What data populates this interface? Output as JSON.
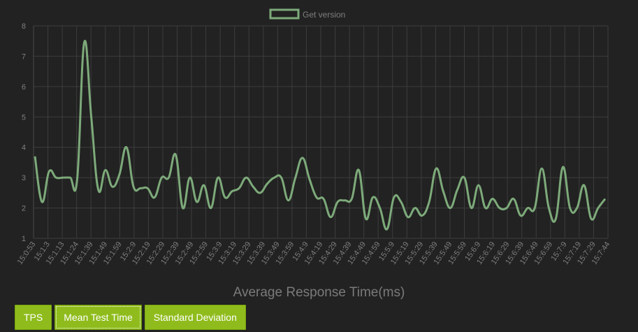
{
  "colors": {
    "background": "#222222",
    "grid": "#3d3d3d",
    "axis_text": "#7f7f7f",
    "series": "#7daa7a",
    "button": "#8fbc1c"
  },
  "buttons": [
    {
      "label": "TPS",
      "active": false
    },
    {
      "label": "Mean Test Time",
      "active": true
    },
    {
      "label": "Standard Deviation",
      "active": false
    }
  ],
  "chart_data": {
    "type": "line",
    "title": "Average Response Time(ms)",
    "legend_position": "top-center",
    "grid": true,
    "ylim": [
      1,
      8
    ],
    "yticks": [
      1,
      2,
      3,
      4,
      5,
      6,
      7,
      8
    ],
    "x": [
      "15:0:53",
      "15:1:3",
      "15:1:13",
      "15:1:24",
      "15:1:39",
      "15:1:49",
      "15:1:59",
      "15:2:9",
      "15:2:19",
      "15:2:29",
      "15:2:39",
      "15:2:49",
      "15:2:59",
      "15:3:9",
      "15:3:19",
      "15:3:29",
      "15:3:39",
      "15:3:49",
      "15:3:59",
      "15:4:9",
      "15:4:19",
      "15:4:29",
      "15:4:39",
      "15:4:49",
      "15:4:59",
      "15:5:9",
      "15:5:19",
      "15:5:29",
      "15:5:39",
      "15:5:49",
      "15:5:59",
      "15:6:9",
      "15:6:19",
      "15:6:29",
      "15:6:39",
      "15:6:49",
      "15:6:59",
      "15:7:9",
      "15:7:19",
      "15:7:29",
      "15:7:44"
    ],
    "series": [
      {
        "name": "Get version",
        "values": [
          3.7,
          2.2,
          3.2,
          3.0,
          3.0,
          3.0,
          2.95,
          7.45,
          5.0,
          2.6,
          3.25,
          2.7,
          3.1,
          4.0,
          2.7,
          2.65,
          2.65,
          2.35,
          3.0,
          3.0,
          3.75,
          2.0,
          3.0,
          2.2,
          2.75,
          2.0,
          3.0,
          2.35,
          2.55,
          2.65,
          3.0,
          2.7,
          2.5,
          2.8,
          3.0,
          3.0,
          2.25,
          3.0,
          3.65,
          2.95,
          2.35,
          2.3,
          1.7,
          2.2,
          2.25,
          2.3,
          3.25,
          1.65,
          2.35,
          2.0,
          1.3,
          2.35,
          2.2,
          1.7,
          2.0,
          1.75,
          2.2,
          3.3,
          2.55,
          2.0,
          2.6,
          3.0,
          2.0,
          2.75,
          2.0,
          2.3,
          2.0,
          2.0,
          2.3,
          1.75,
          2.0,
          2.0,
          3.3,
          2.0,
          1.65,
          3.35,
          2.0,
          2.0,
          2.75,
          1.65,
          2.0,
          2.3
        ]
      }
    ]
  }
}
